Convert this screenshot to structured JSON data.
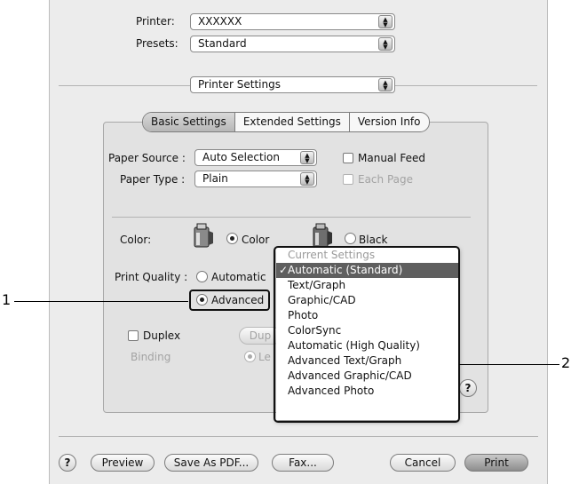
{
  "top": {
    "printer_label": "Printer:",
    "printer_value": "XXXXXX",
    "presets_label": "Presets:",
    "presets_value": "Standard",
    "panel_value": "Printer Settings"
  },
  "tabs": [
    "Basic Settings",
    "Extended Settings",
    "Version Info"
  ],
  "paper": {
    "source_label": "Paper Source :",
    "source_value": "Auto Selection",
    "type_label": "Paper Type :",
    "type_value": "Plain",
    "manual_feed": "Manual Feed",
    "each_page": "Each Page"
  },
  "color": {
    "label": "Color:",
    "color_option": "Color",
    "black_option": "Black"
  },
  "quality": {
    "label": "Print Quality :",
    "automatic": "Automatic",
    "advanced": "Advanced",
    "partial_button": "Dup",
    "partial_radio": "Le"
  },
  "duplex": {
    "label": "Duplex",
    "binding_label": "Binding"
  },
  "menu": {
    "header": "Current Settings",
    "items": [
      "Automatic (Standard)",
      "Text/Graph",
      "Graphic/CAD",
      "Photo",
      "ColorSync",
      "Automatic (High Quality)",
      "Advanced Text/Graph",
      "Advanced Graphic/CAD",
      "Advanced Photo"
    ],
    "checkmark": "✓"
  },
  "buttons": {
    "help": "?",
    "preview": "Preview",
    "save_pdf": "Save As PDF...",
    "fax": "Fax...",
    "cancel": "Cancel",
    "print": "Print"
  },
  "callouts": {
    "one": "1",
    "two": "2"
  }
}
